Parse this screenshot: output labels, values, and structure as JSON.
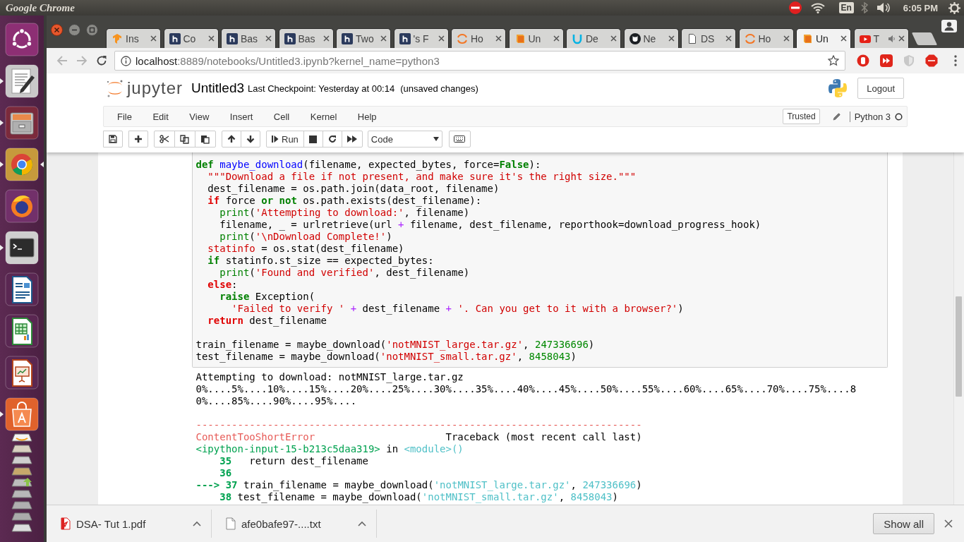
{
  "top_panel": {
    "app_title": "Google Chrome",
    "keyboard_layout": "En",
    "clock": "6:05 PM"
  },
  "launcher": [
    {
      "kind": "ubuntu",
      "running": false,
      "focused": false
    },
    {
      "kind": "editor",
      "running": true,
      "focused": false
    },
    {
      "kind": "files",
      "running": true,
      "focused": false
    },
    {
      "kind": "chrome",
      "running": true,
      "focused": true
    },
    {
      "kind": "firefox",
      "running": false,
      "focused": false
    },
    {
      "kind": "terminal",
      "running": true,
      "focused": false
    },
    {
      "kind": "writer",
      "running": false,
      "focused": false
    },
    {
      "kind": "calc",
      "running": false,
      "focused": false
    },
    {
      "kind": "impress",
      "running": false,
      "focused": false
    },
    {
      "kind": "software",
      "running": true,
      "focused": false
    },
    {
      "kind": "stack",
      "running": false,
      "focused": false
    }
  ],
  "tabs": [
    {
      "title": "Ins",
      "kind": "flame",
      "selected": false,
      "audible": false
    },
    {
      "title": "Co",
      "kind": "square",
      "selected": false,
      "audible": false
    },
    {
      "title": "Bas",
      "kind": "square",
      "selected": false,
      "audible": false
    },
    {
      "title": "Bas",
      "kind": "square",
      "selected": false,
      "audible": false
    },
    {
      "title": "Two",
      "kind": "square",
      "selected": false,
      "audible": false
    },
    {
      "title": "'s F",
      "kind": "square",
      "selected": false,
      "audible": false
    },
    {
      "title": "Ho",
      "kind": "arc",
      "selected": false,
      "audible": false
    },
    {
      "title": "Un",
      "kind": "book",
      "selected": false,
      "audible": false
    },
    {
      "title": "De",
      "kind": "u",
      "selected": false,
      "audible": false
    },
    {
      "title": "Ne",
      "kind": "cat",
      "selected": false,
      "audible": false
    },
    {
      "title": "DS",
      "kind": "page",
      "selected": false,
      "audible": false
    },
    {
      "title": "Ho",
      "kind": "arc",
      "selected": false,
      "audible": false
    },
    {
      "title": "Un",
      "kind": "book",
      "selected": true,
      "audible": false
    },
    {
      "title": "T",
      "kind": "play",
      "selected": false,
      "audible": true
    }
  ],
  "address": {
    "host": "localhost",
    "path": ":8889/notebooks/Untitled3.ipynb?kernel_name=python3"
  },
  "extensions": [
    {
      "kind": "stop"
    },
    {
      "kind": "forward"
    },
    {
      "kind": "shield"
    },
    {
      "kind": "adblock"
    }
  ],
  "jupyter": {
    "logo_text": "jupyter",
    "notebook_name": "Untitled3",
    "checkpoint": "Last Checkpoint: Yesterday at 00:14",
    "autosave_status": "(unsaved changes)",
    "logout": "Logout",
    "menu": [
      "File",
      "Edit",
      "View",
      "Insert",
      "Cell",
      "Kernel",
      "Help"
    ],
    "trusted": "Trusted",
    "kernel_name": "Python 3",
    "toolbar": [
      [
        {
          "kind": "save"
        }
      ],
      [
        {
          "kind": "insert"
        }
      ],
      [
        {
          "kind": "cut"
        },
        {
          "kind": "copy"
        },
        {
          "kind": "paste"
        }
      ],
      [
        {
          "kind": "up"
        },
        {
          "kind": "down"
        }
      ],
      [
        {
          "kind": "run",
          "label": "Run"
        },
        {
          "kind": "stop"
        },
        {
          "kind": "restart"
        },
        {
          "kind": "run-all"
        }
      ]
    ],
    "cell_type": "Code"
  },
  "code": [
    [
      [
        {
          "t": "def",
          "kind": "keyword"
        },
        {
          "t": " maybe_download",
          "kind": "def-name"
        },
        {
          "t": "(filename, expected_bytes, force=",
          "kind": "plain"
        },
        {
          "t": "False",
          "kind": "keyword"
        },
        {
          "t": "):",
          "kind": "plain"
        }
      ],
      [
        {
          "t": "  \"\"\"Download a file if not present, and make sure it's the right size.\"\"\"",
          "kind": "string"
        }
      ],
      [
        {
          "t": "  dest_filename = os.path.join(data_root, filename)",
          "kind": "plain"
        }
      ],
      [
        {
          "t": "  if",
          "kind": "keyword-alt"
        },
        {
          "t": " force ",
          "kind": "plain"
        },
        {
          "t": "or",
          "kind": "keyword"
        },
        {
          "t": " not",
          "kind": "keyword"
        },
        {
          "t": " os.path.exists(dest_filename):",
          "kind": "plain"
        }
      ],
      [
        {
          "t": "    print",
          "kind": "builtin"
        },
        {
          "t": "(",
          "kind": "plain"
        },
        {
          "t": "'Attempting to download:'",
          "kind": "string"
        },
        {
          "t": ", filename)",
          "kind": "plain"
        }
      ],
      [
        {
          "t": "    filename, _ = urlretrieve(url ",
          "kind": "plain"
        },
        {
          "t": "+",
          "kind": "operator"
        },
        {
          "t": " filename, dest_filename, reporthook=download_progress_hook)",
          "kind": "plain"
        }
      ],
      [
        {
          "t": "    print",
          "kind": "builtin"
        },
        {
          "t": "(",
          "kind": "plain"
        },
        {
          "t": "'\\nDownload Complete!'",
          "kind": "string"
        },
        {
          "t": ")",
          "kind": "plain"
        }
      ],
      [
        {
          "t": "  statinfo",
          "kind": "variable-alt"
        },
        {
          "t": " = os.stat(dest_filename)",
          "kind": "plain"
        }
      ],
      [
        {
          "t": "  if",
          "kind": "keyword"
        },
        {
          "t": " statinfo.st_size == expected_bytes:",
          "kind": "plain"
        }
      ],
      [
        {
          "t": "    print",
          "kind": "builtin"
        },
        {
          "t": "(",
          "kind": "plain"
        },
        {
          "t": "'Found and verified'",
          "kind": "string"
        },
        {
          "t": ", dest_filename)",
          "kind": "plain"
        }
      ],
      [
        {
          "t": "  else",
          "kind": "keyword-alt"
        },
        {
          "t": ":",
          "kind": "plain"
        }
      ],
      [
        {
          "t": "    raise",
          "kind": "keyword"
        },
        {
          "t": " Exception(",
          "kind": "plain"
        }
      ],
      [
        {
          "t": "      'Failed to verify '",
          "kind": "string"
        },
        {
          "t": " +",
          "kind": "operator"
        },
        {
          "t": " dest_filename ",
          "kind": "plain"
        },
        {
          "t": "+",
          "kind": "operator"
        },
        {
          "t": " '. Can you get to it with a browser?'",
          "kind": "string"
        },
        {
          "t": ")",
          "kind": "plain"
        }
      ],
      [
        {
          "t": "  return",
          "kind": "keyword-alt"
        },
        {
          "t": " dest_filename",
          "kind": "plain"
        }
      ]
    ],
    [
      [
        {
          "t": "train_filename = maybe_download(",
          "kind": "plain"
        },
        {
          "t": "'notMNIST_large.tar.gz'",
          "kind": "string"
        },
        {
          "t": ", ",
          "kind": "plain"
        },
        {
          "t": "247336696",
          "kind": "number"
        },
        {
          "t": ")",
          "kind": "plain"
        }
      ],
      [
        {
          "t": "test_filename = maybe_download(",
          "kind": "plain"
        },
        {
          "t": "'notMNIST_small.tar.gz'",
          "kind": "string"
        },
        {
          "t": ", ",
          "kind": "plain"
        },
        {
          "t": "8458043",
          "kind": "number"
        },
        {
          "t": ")",
          "kind": "plain"
        }
      ]
    ]
  ],
  "output": [
    [
      [
        {
          "t": "Attempting to download: notMNIST_large.tar.gz",
          "kind": "plain"
        }
      ],
      [
        {
          "t": "0%....5%....10%....15%....20%....25%....30%....35%....40%....45%....50%....55%....60%....65%....70%....75%....8",
          "kind": "plain"
        }
      ],
      [
        {
          "t": "0%....85%....90%....95%....",
          "kind": "plain"
        }
      ]
    ],
    [
      [
        {
          "t": "---------------------------------------------------------------------------",
          "kind": "ansi-red"
        }
      ],
      [
        {
          "t": "ContentTooShortError",
          "kind": "ansi-red"
        },
        {
          "t": "                      Traceback (most recent call last)",
          "kind": "plain"
        }
      ],
      [
        {
          "t": "<ipython-input-15-b213c5daa319>",
          "kind": "ansi-green"
        },
        {
          "t": " in ",
          "kind": "plain"
        },
        {
          "t": "<module>()",
          "kind": "ansi-cyan"
        }
      ],
      [
        {
          "t": "    35",
          "kind": "ansi-green-bold"
        },
        {
          "t": "   return dest_filename",
          "kind": "plain"
        }
      ],
      [
        {
          "t": "    36",
          "kind": "ansi-green-bold"
        }
      ],
      [
        {
          "t": "---> 37",
          "kind": "ansi-green-bold"
        },
        {
          "t": " train_filename = maybe_download(",
          "kind": "plain"
        },
        {
          "t": "'notMNIST_large.tar.gz'",
          "kind": "ansi-cyan"
        },
        {
          "t": ", ",
          "kind": "plain"
        },
        {
          "t": "247336696",
          "kind": "ansi-cyan"
        },
        {
          "t": ")",
          "kind": "plain"
        }
      ],
      [
        {
          "t": "    38",
          "kind": "ansi-green-bold"
        },
        {
          "t": " test_filename = maybe_download(",
          "kind": "plain"
        },
        {
          "t": "'notMNIST_small.tar.gz'",
          "kind": "ansi-cyan"
        },
        {
          "t": ", ",
          "kind": "plain"
        },
        {
          "t": "8458043",
          "kind": "ansi-cyan"
        },
        {
          "t": ")",
          "kind": "plain"
        }
      ]
    ]
  ],
  "downloads": [
    {
      "name": "DSA- Tut 1.pdf",
      "kind": "pdf"
    },
    {
      "name": "afe0bafe97-....txt",
      "kind": "text"
    }
  ],
  "show_all": "Show all"
}
